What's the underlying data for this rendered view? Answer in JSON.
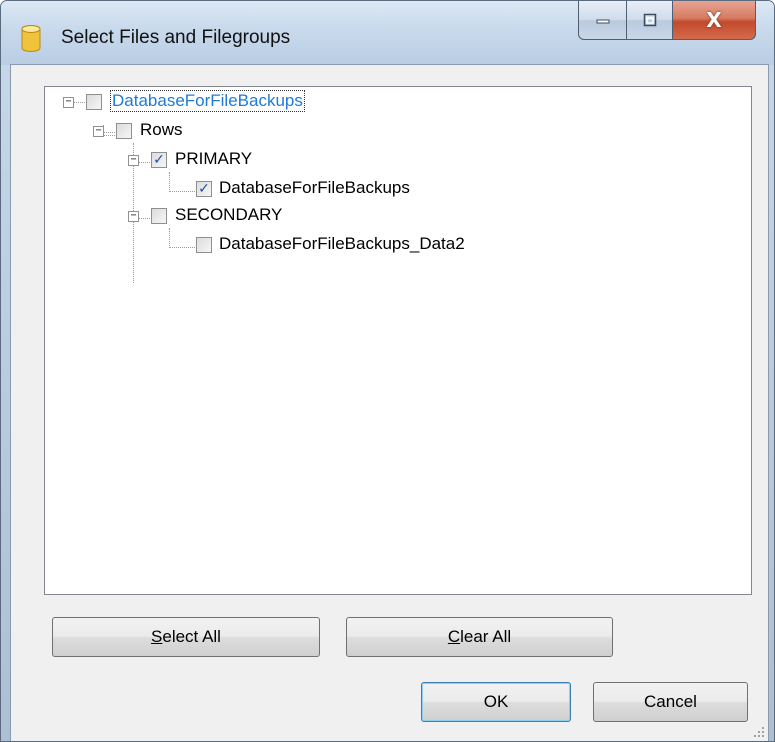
{
  "window": {
    "title": "Select Files and Filegroups",
    "caption": {
      "minimize": "minimize",
      "maximize": "maximize",
      "close": "X"
    }
  },
  "tree": {
    "root": {
      "label": "DatabaseForFileBackups",
      "checked": false,
      "expanded": true,
      "selected": true
    },
    "rows": {
      "label": "Rows",
      "checked": false,
      "expanded": true
    },
    "primary": {
      "label": "PRIMARY",
      "checked": true,
      "expanded": true
    },
    "primary_file": {
      "label": "DatabaseForFileBackups",
      "checked": true
    },
    "secondary": {
      "label": "SECONDARY",
      "checked": false,
      "expanded": true
    },
    "secondary_file": {
      "label": "DatabaseForFileBackups_Data2",
      "checked": false
    }
  },
  "buttons": {
    "select_all": {
      "label_accel": "S",
      "label_rest": "elect All"
    },
    "clear_all": {
      "label_accel": "C",
      "label_rest": "lear All"
    },
    "ok": "OK",
    "cancel": "Cancel"
  },
  "colors": {
    "selection_text": "#1e7bd8",
    "check_mark": "#1c4fa8",
    "close_button": "#c24a2c"
  }
}
